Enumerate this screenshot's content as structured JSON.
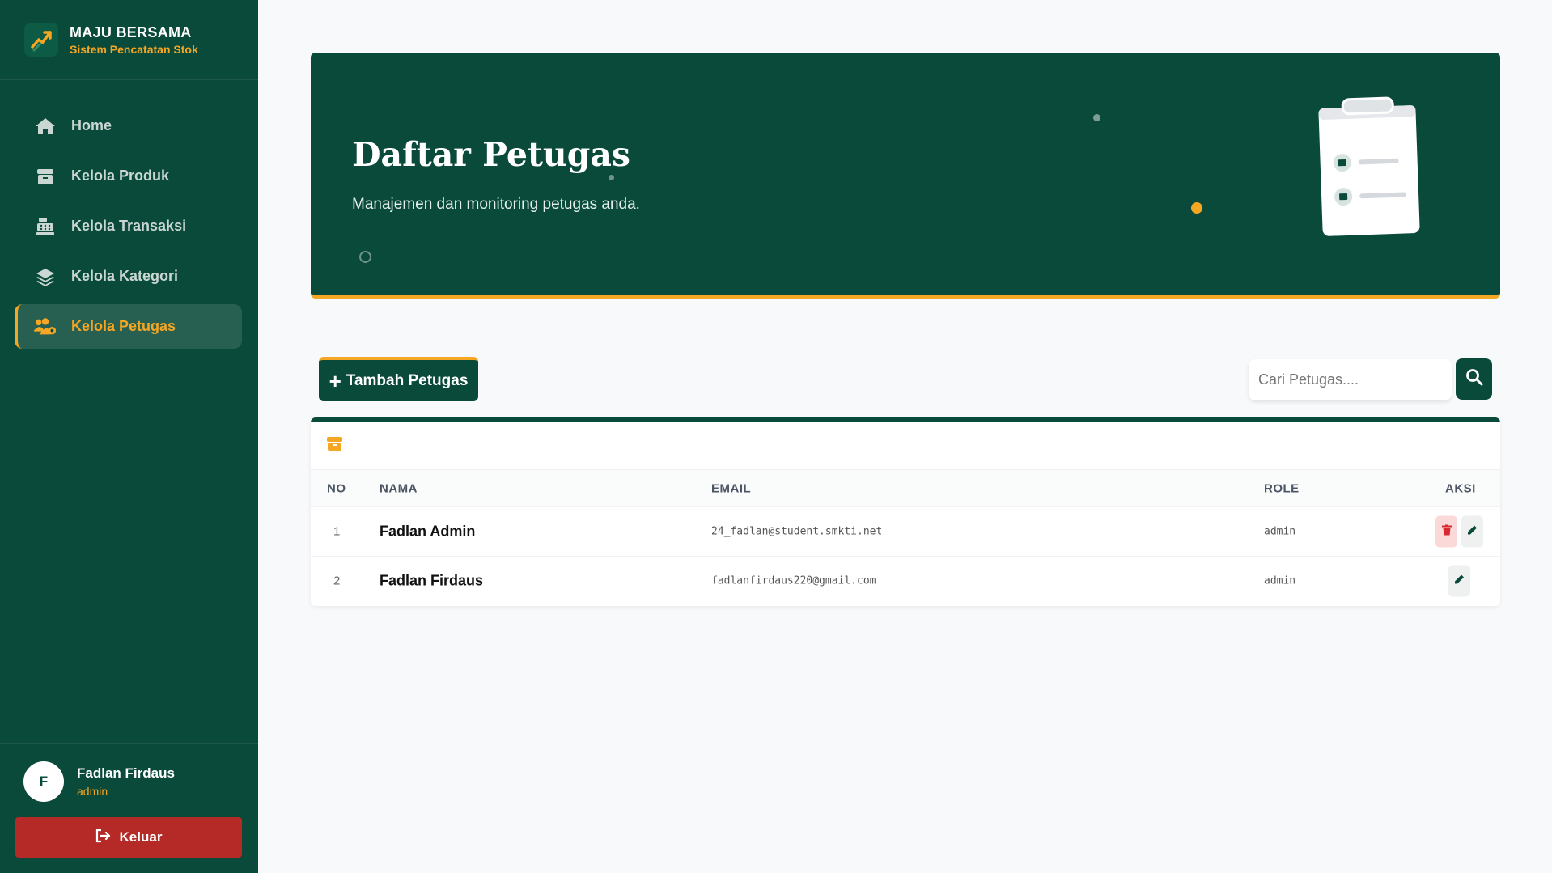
{
  "brand": {
    "title": "MAJU BERSAMA",
    "subtitle": "Sistem Pencatatan Stok",
    "logo_icon": "trending-up-icon"
  },
  "nav": [
    {
      "label": "Home",
      "icon": "home-icon",
      "active": false
    },
    {
      "label": "Kelola Produk",
      "icon": "box-icon",
      "active": false
    },
    {
      "label": "Kelola Transaksi",
      "icon": "cash-register-icon",
      "active": false
    },
    {
      "label": "Kelola Kategori",
      "icon": "layers-icon",
      "active": false
    },
    {
      "label": "Kelola Petugas",
      "icon": "users-gear-icon",
      "active": true
    }
  ],
  "user": {
    "initial": "F",
    "name": "Fadlan Firdaus",
    "role": "admin"
  },
  "logout_label": "Keluar",
  "hero": {
    "title": "Daftar Petugas",
    "subtitle": "Manajemen dan monitoring petugas anda."
  },
  "toolbar": {
    "add_label": "Tambah Petugas",
    "search_placeholder": "Cari Petugas...."
  },
  "table": {
    "headers": {
      "no": "NO",
      "name": "NAMA",
      "email": "EMAIL",
      "role": "ROLE",
      "action": "AKSI"
    },
    "rows": [
      {
        "no": "1",
        "name": "Fadlan Admin",
        "email": "24_fadlan@student.smkti.net",
        "role": "admin",
        "actions": [
          "delete",
          "edit"
        ]
      },
      {
        "no": "2",
        "name": "Fadlan Firdaus",
        "email": "fadlanfirdaus220@gmail.com",
        "role": "admin",
        "actions": [
          "edit"
        ]
      }
    ]
  },
  "colors": {
    "primary": "#0a4a3a",
    "accent": "#f5a623",
    "danger": "#b52a26"
  }
}
